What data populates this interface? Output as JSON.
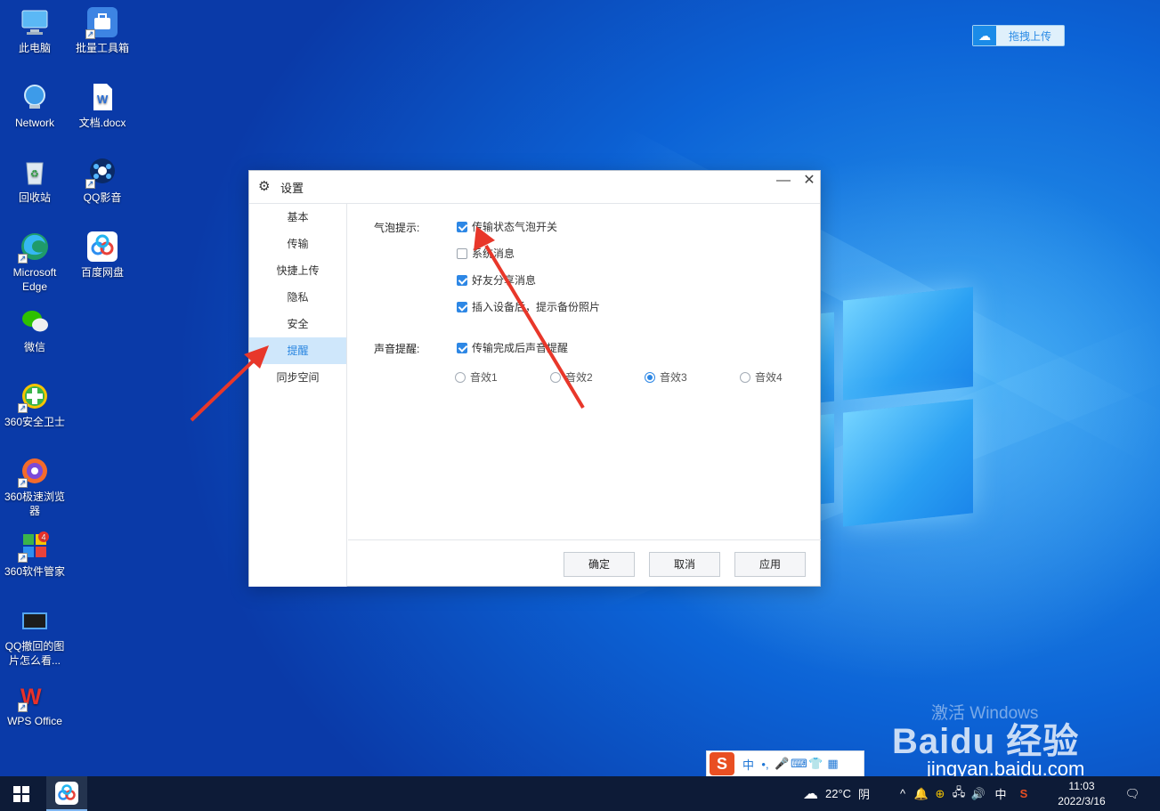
{
  "desktop": {
    "icons": [
      {
        "label": "此电脑",
        "icon": "computer-icon"
      },
      {
        "label": "批量工具箱",
        "icon": "toolbox-icon"
      },
      {
        "label": "Network",
        "icon": "network-icon"
      },
      {
        "label": "文档.docx",
        "icon": "word-doc-icon"
      },
      {
        "label": "回收站",
        "icon": "recycle-bin-icon"
      },
      {
        "label": "QQ影音",
        "icon": "qq-player-icon"
      },
      {
        "label": "Microsoft Edge",
        "icon": "edge-icon"
      },
      {
        "label": "百度网盘",
        "icon": "baidu-netdisk-icon"
      },
      {
        "label": "微信",
        "icon": "wechat-icon"
      },
      {
        "label": "360安全卫士",
        "icon": "360-security-icon"
      },
      {
        "label": "360极速浏览器",
        "icon": "360-browser-icon"
      },
      {
        "label": "360软件管家",
        "icon": "360-software-icon"
      },
      {
        "label": "QQ撤回的图片怎么看...",
        "icon": "image-file-icon"
      },
      {
        "label": "WPS Office",
        "icon": "wps-icon"
      }
    ],
    "software_badge": "4"
  },
  "drag_upload": {
    "label": "拖拽上传"
  },
  "dialog": {
    "title": "设置",
    "minimize": "—",
    "close": "✕",
    "nav": [
      "基本",
      "传输",
      "快捷上传",
      "隐私",
      "安全",
      "提醒",
      "同步空间"
    ],
    "active_nav": "提醒",
    "bubble": {
      "label": "气泡提示:",
      "options": [
        {
          "label": "传输状态气泡开关",
          "checked": true
        },
        {
          "label": "系统消息",
          "checked": false
        },
        {
          "label": "好友分享消息",
          "checked": true
        },
        {
          "label": "插入设备后，提示备份照片",
          "checked": true
        }
      ]
    },
    "sound": {
      "label": "声音提醒:",
      "option": {
        "label": "传输完成后声音提醒",
        "checked": true
      },
      "effects": [
        "音效1",
        "音效2",
        "音效3",
        "音效4"
      ],
      "selected_effect": "音效3"
    },
    "buttons": {
      "ok": "确定",
      "cancel": "取消",
      "apply": "应用"
    }
  },
  "watermark": {
    "activate": "激活 Windows",
    "brand": "Baidu 经验",
    "url": "jingyan.baidu.com"
  },
  "ime_bar": {
    "logo": "S",
    "mode": "中",
    "punct": "•,",
    "mic": "🎤",
    "kbd": "⌨",
    "skin": "👕",
    "apps": "▦"
  },
  "taskbar": {
    "weather_temp": "22°C",
    "weather_desc": "阴",
    "ime_mode": "中",
    "time": "11:03",
    "date": "2022/3/16"
  },
  "colors": {
    "accent": "#2d87e5",
    "active_nav_bg": "#cfe7fb",
    "arrow": "#e8372a",
    "taskbar": "#0d1b37"
  }
}
